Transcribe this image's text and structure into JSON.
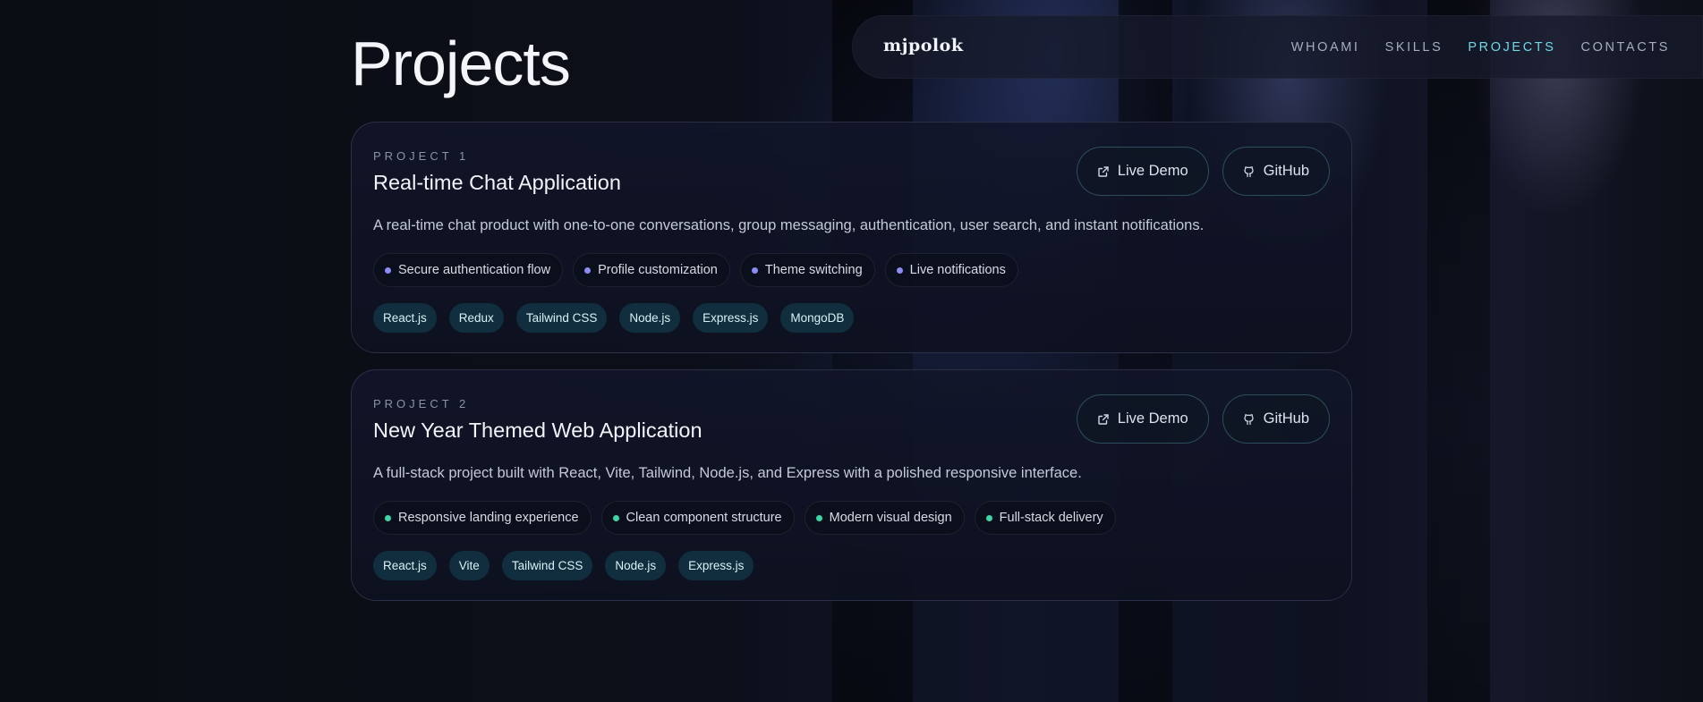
{
  "nav": {
    "brand": "mjpolok",
    "links": [
      {
        "label": "WHOAMI",
        "active": false
      },
      {
        "label": "SKILLS",
        "active": false
      },
      {
        "label": "PROJECTS",
        "active": true
      },
      {
        "label": "CONTACTS",
        "active": false
      }
    ]
  },
  "page": {
    "title": "Projects"
  },
  "projects": [
    {
      "eyebrow": "PROJECT 1",
      "title": "Real-time Chat Application",
      "description": "A real-time chat product with one-to-one conversations, group messaging, authentication, user search, and instant notifications.",
      "live_demo_label": "Live Demo",
      "github_label": "GitHub",
      "dot_color": "#8b8cf4",
      "features": [
        "Secure authentication flow",
        "Profile customization",
        "Theme switching",
        "Live notifications"
      ],
      "tags": [
        "React.js",
        "Redux",
        "Tailwind CSS",
        "Node.js",
        "Express.js",
        "MongoDB"
      ]
    },
    {
      "eyebrow": "PROJECT 2",
      "title": "New Year Themed Web Application",
      "description": "A full-stack project built with React, Vite, Tailwind, Node.js, and Express with a polished responsive interface.",
      "live_demo_label": "Live Demo",
      "github_label": "GitHub",
      "dot_color": "#3ed6a6",
      "features": [
        "Responsive landing experience",
        "Clean component structure",
        "Modern visual design",
        "Full-stack delivery"
      ],
      "tags": [
        "React.js",
        "Vite",
        "Tailwind CSS",
        "Node.js",
        "Express.js"
      ]
    }
  ],
  "colors": {
    "accent": "#6fd8e6",
    "tag_bg": "#112e3e",
    "background": "#0c0e16"
  },
  "icons": {
    "live_demo": "external-link-icon",
    "github": "github-icon"
  }
}
